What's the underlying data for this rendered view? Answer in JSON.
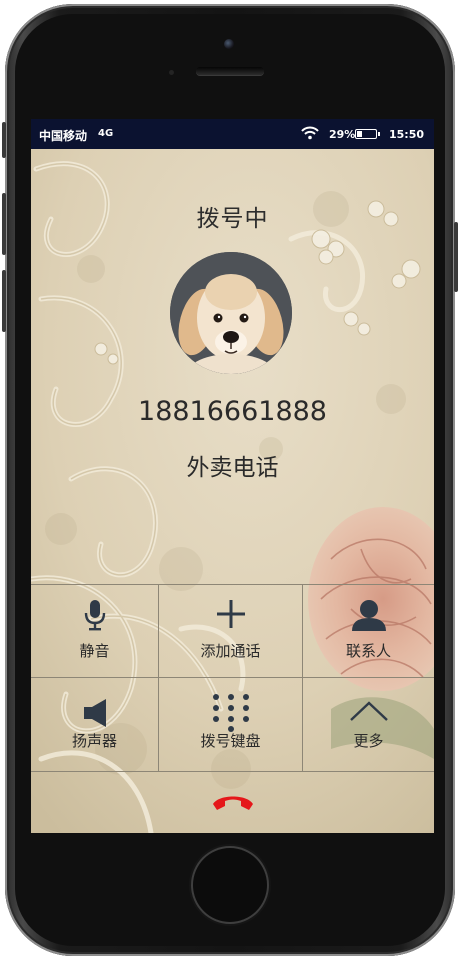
{
  "status_bar": {
    "carrier": "中国移动",
    "network": "4G",
    "battery_percent": "29%",
    "battery_level": 0.29,
    "time": "15:50"
  },
  "call": {
    "status": "拨号中",
    "number": "18816661888",
    "name": "外卖电话"
  },
  "controls": {
    "mute": {
      "label": "静音",
      "icon": "microphone-icon"
    },
    "add_call": {
      "label": "添加通话",
      "icon": "plus-icon"
    },
    "contacts": {
      "label": "联系人",
      "icon": "person-icon"
    },
    "speaker": {
      "label": "扬声器",
      "icon": "speaker-icon"
    },
    "keypad": {
      "label": "拨号键盘",
      "icon": "dialpad-icon"
    },
    "more": {
      "label": "更多",
      "icon": "chevron-up-icon"
    },
    "hangup": {
      "icon": "hangup-icon"
    }
  },
  "colors": {
    "status_bar": "#0b1230",
    "hangup": "#e5171a",
    "icon": "#2f3a47",
    "text": "#2b2b2b"
  }
}
